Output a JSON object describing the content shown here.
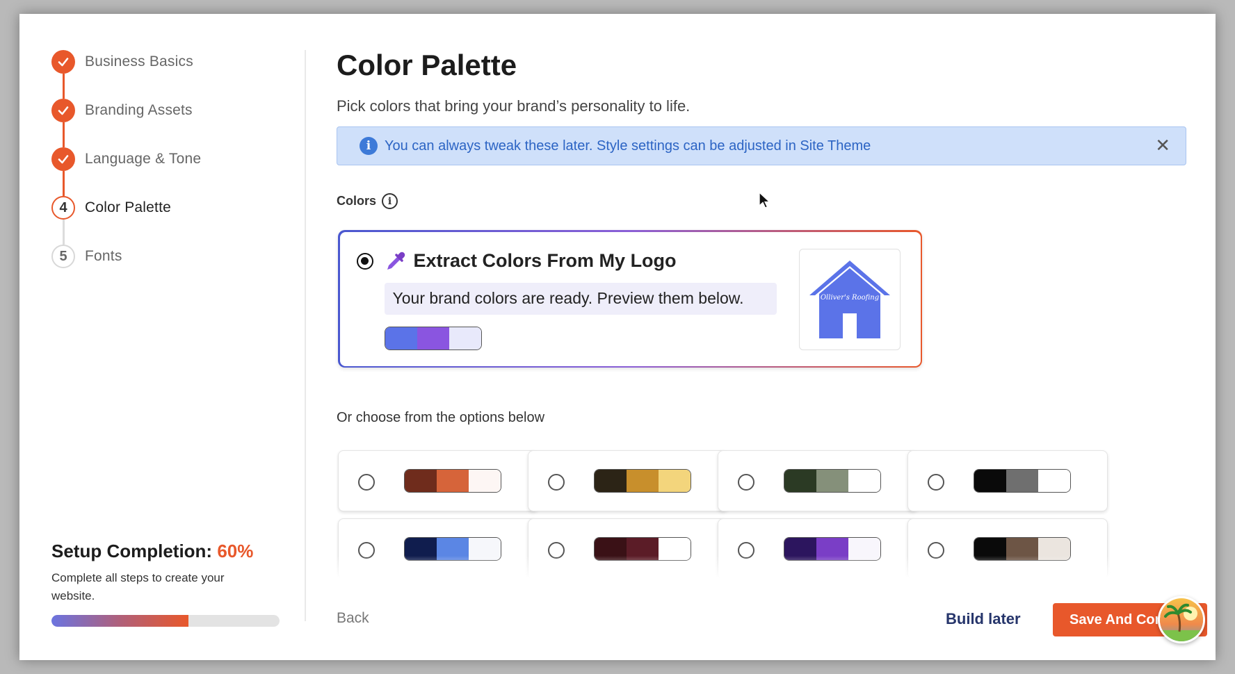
{
  "steps": [
    {
      "number": "1",
      "label": "Business Basics",
      "status": "done"
    },
    {
      "number": "2",
      "label": "Branding Assets",
      "status": "done"
    },
    {
      "number": "3",
      "label": "Language & Tone",
      "status": "done"
    },
    {
      "number": "4",
      "label": "Color Palette",
      "status": "current"
    },
    {
      "number": "5",
      "label": "Fonts",
      "status": "pending"
    }
  ],
  "completion": {
    "title": "Setup Completion:",
    "percent_label": "60%",
    "percent": 0.6,
    "description": "Complete all steps to create your website."
  },
  "main": {
    "title": "Color Palette",
    "subtitle": "Pick colors that bring your brand’s personality to life.",
    "banner": {
      "text": "You can always tweak these later. Style settings can be adjusted in Site Theme",
      "close_icon": "close-icon"
    },
    "colors_label": "Colors",
    "logo_option": {
      "heading": "Extract Colors From My Logo",
      "ready_text": "Your brand colors are ready. Preview them below.",
      "selected": true,
      "swatch": [
        "#5b73e8",
        "#8a55e0",
        "#e8e9fb"
      ],
      "logo_text": "Olliver's Roofing"
    },
    "or_label": "Or choose from the options below",
    "palettes": [
      [
        "#6f2c1c",
        "#d6643a",
        "#fdf6f4"
      ],
      [
        "#2c2416",
        "#c88f2c",
        "#f3d57c"
      ],
      [
        "#2b3a24",
        "#85907a",
        "#ffffff"
      ],
      [
        "#0a0a0a",
        "#6f6f6f",
        "#ffffff"
      ],
      [
        "#101d4e",
        "#5b86e4",
        "#f6f7fb"
      ],
      [
        "#3a1116",
        "#5b1c27",
        "#ffffff"
      ],
      [
        "#2c155e",
        "#7a3ec6",
        "#f8f6fc"
      ],
      [
        "#0a0a0a",
        "#6d5545",
        "#ebe5df"
      ]
    ]
  },
  "footer": {
    "back": "Back",
    "build_later": "Build later",
    "save": "Save And Continue"
  },
  "colors": {
    "accent": "#e8582b",
    "info_bg": "#cfe0fa",
    "info_text": "#2c64c4",
    "navy": "#26356b"
  }
}
